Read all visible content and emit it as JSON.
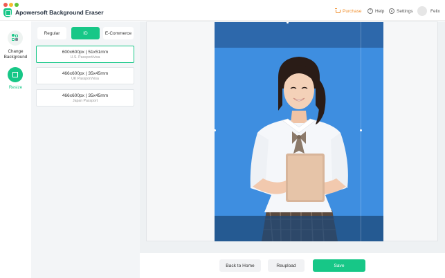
{
  "window": {
    "title": "Apowersoft Background Eraser"
  },
  "header": {
    "purchase_label": "Purchase",
    "help_label": "Help",
    "settings_label": "Settings",
    "user_name": "Felix"
  },
  "sidebar": {
    "items": [
      {
        "label": "Change Background",
        "icon": "change-background-icon"
      },
      {
        "label": "Resize",
        "icon": "resize-icon",
        "active": true
      }
    ]
  },
  "tabs": [
    {
      "label": "Regular"
    },
    {
      "label": "ID",
      "active": true
    },
    {
      "label": "E-Commerce"
    }
  ],
  "sizes": [
    {
      "dimensions": "600x600px  |  51x51mm",
      "name": "U.S. Passport/visa",
      "selected": true
    },
    {
      "dimensions": "466x600px  |  35x45mm",
      "name": "UK Passport/visa"
    },
    {
      "dimensions": "466x600px  |  35x45mm",
      "name": "Japan Passport"
    }
  ],
  "actions": {
    "back_home": "Back to Home",
    "reupload": "Reupload",
    "save": "Save"
  },
  "colors": {
    "accent": "#17c787",
    "photo_background": "#3e8ee0",
    "purchase": "#f08d2a"
  }
}
